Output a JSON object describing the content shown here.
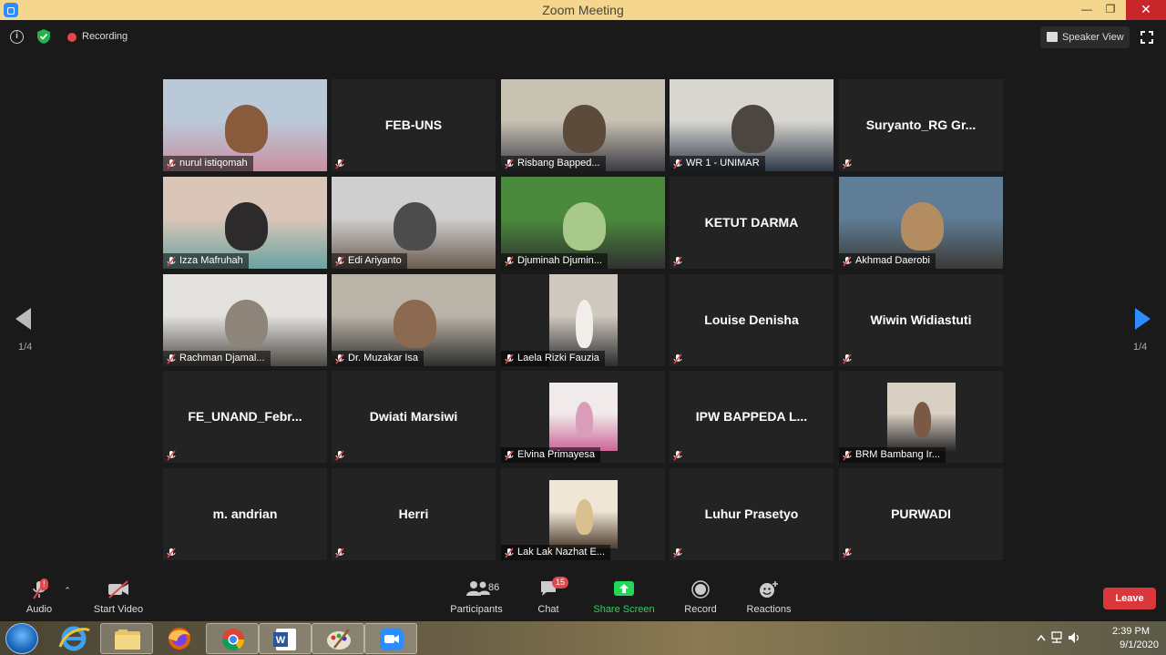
{
  "window": {
    "title": "Zoom Meeting"
  },
  "top_bar": {
    "recording_label": "Recording",
    "speaker_view_label": "Speaker View"
  },
  "pagination": {
    "left": "1/4",
    "right": "1/4"
  },
  "tiles": [
    {
      "name": "nurul istiqomah",
      "video": true
    },
    {
      "name": "FEB-UNS",
      "video": false
    },
    {
      "name": "Risbang Bapped...",
      "video": true
    },
    {
      "name": "WR 1 - UNIMAR",
      "video": true
    },
    {
      "name": "Suryanto_RG  Gr...",
      "video": false
    },
    {
      "name": "Izza Mafruhah",
      "video": true,
      "active_speaker": true
    },
    {
      "name": "Edi Ariyanto",
      "video": true
    },
    {
      "name": "Djuminah Djumin...",
      "video": true
    },
    {
      "name": "KETUT DARMA",
      "video": false
    },
    {
      "name": "Akhmad Daerobi",
      "video": true
    },
    {
      "name": "Rachman Djamal...",
      "video": true
    },
    {
      "name": "Dr. Muzakar Isa",
      "video": true
    },
    {
      "name": "Laela Rizki Fauzia",
      "video": true
    },
    {
      "name": "Louise Denisha",
      "video": false
    },
    {
      "name": "Wiwin Widiastuti",
      "video": false
    },
    {
      "name": "FE_UNAND_Febr...",
      "video": false
    },
    {
      "name": "Dwiati Marsiwi",
      "video": false
    },
    {
      "name": "Elvina Primayesa",
      "video": true
    },
    {
      "name": "IPW BAPPEDA L...",
      "video": false
    },
    {
      "name": "BRM Bambang Ir...",
      "video": true
    },
    {
      "name": "m. andrian",
      "video": false
    },
    {
      "name": "Herri",
      "video": false
    },
    {
      "name": "Lak Lak Nazhat E...",
      "video": true
    },
    {
      "name": "Luhur Prasetyo",
      "video": false
    },
    {
      "name": "PURWADI",
      "video": false
    }
  ],
  "toolbar": {
    "audio": "Audio",
    "start_video": "Start Video",
    "participants": "Participants",
    "participants_count": "86",
    "chat": "Chat",
    "chat_badge": "15",
    "share_screen": "Share Screen",
    "record": "Record",
    "reactions": "Reactions",
    "leave": "Leave",
    "audio_alert": "!"
  },
  "taskbar": {
    "apps": [
      "start-button",
      "internet-explorer",
      "file-explorer",
      "firefox",
      "chrome",
      "word",
      "paint",
      "zoom"
    ],
    "time": "2:39 PM",
    "date": "9/1/2020"
  },
  "colors": {
    "title_bar": "#f4d68c",
    "active_speaker_border": "#d8e06b",
    "share_screen_green": "#23d959",
    "leave_red": "#d9373b",
    "nav_blue": "#2d8cff"
  }
}
